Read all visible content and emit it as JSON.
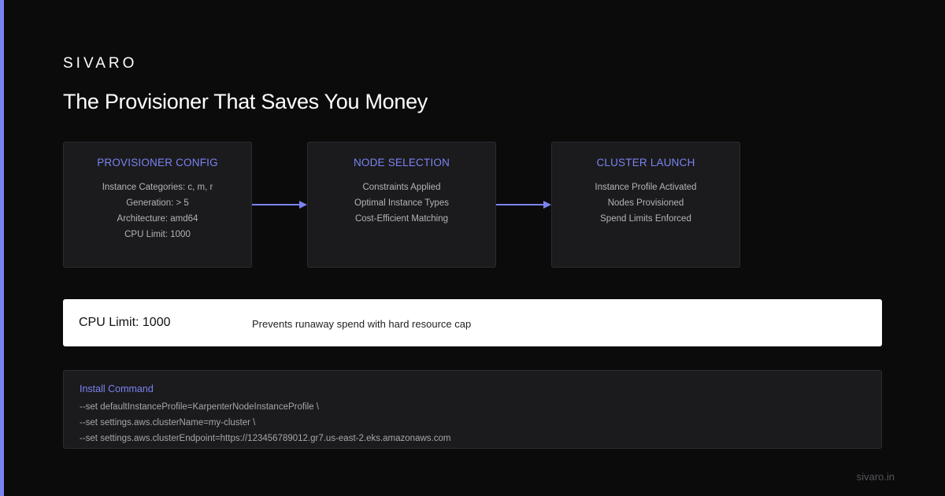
{
  "brand": "SIVARO",
  "headline": "The Provisioner That Saves You Money",
  "steps": [
    {
      "title": "PROVISIONER CONFIG",
      "lines": [
        "Instance Categories: c, m, r",
        "Generation: > 5",
        "Architecture: amd64",
        "CPU Limit: 1000"
      ]
    },
    {
      "title": "NODE SELECTION",
      "lines": [
        "Constraints Applied",
        "Optimal Instance Types",
        "Cost-Efficient Matching"
      ]
    },
    {
      "title": "CLUSTER LAUNCH",
      "lines": [
        "Instance Profile Activated",
        "Nodes Provisioned",
        "Spend Limits Enforced"
      ]
    }
  ],
  "callout": {
    "key": "CPU Limit: 1000",
    "description": "Prevents runaway spend with hard resource cap"
  },
  "install": {
    "title": "Install Command",
    "lines": [
      "--set defaultInstanceProfile=KarpenterNodeInstanceProfile \\",
      "--set settings.aws.clusterName=my-cluster \\",
      "--set settings.aws.clusterEndpoint=https://123456789012.gr7.us-east-2.eks.amazonaws.com"
    ]
  },
  "footer": "sivaro.in",
  "colors": {
    "accent": "#7b83f0",
    "background": "#0b0b0c",
    "card": "#1b1b1e"
  }
}
